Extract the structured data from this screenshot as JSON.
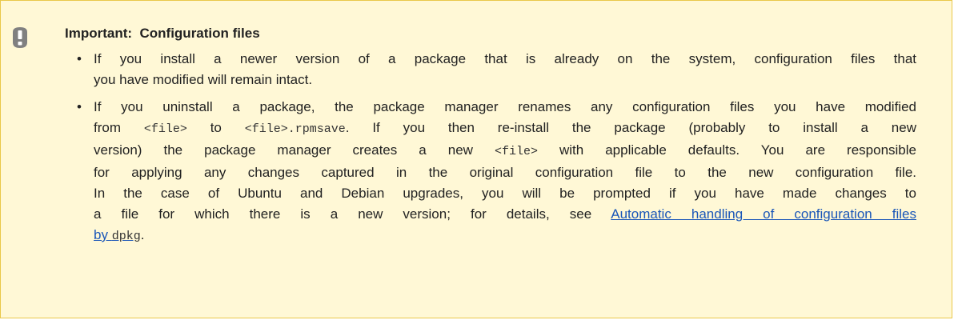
{
  "admonition": {
    "icon": "exclamation-icon",
    "title": "Important:  Configuration files",
    "colors": {
      "background": "#fff8d6",
      "border": "#e9c84a",
      "icon": "#808080",
      "link": "#1a56b8"
    }
  },
  "bullet1": {
    "l1": "If you install a newer version of a package that is already on the system, configuration files that",
    "l2": "you have modified will remain intact."
  },
  "bullet2": {
    "l1": "If you uninstall a package, the package manager renames any configuration files you have modified",
    "l2a": "from ",
    "l2code1": "<file>",
    "l2b": " to ",
    "l2code2": "<file>.rpmsave",
    "l2c": ". If you then re-install the package (probably to install a new",
    "l3a": "version) the package manager creates a new ",
    "l3code": "<file>",
    "l3b": " with applicable defaults. You are responsible",
    "l4": "for applying any changes captured in the original configuration file to the new configuration file.",
    "l5": "In the case of Ubuntu and Debian upgrades, you will be prompted if you have made changes to",
    "l6a": "a file for which there is a new version; for details, see ",
    "l6link": "Automatic handling of configuration files",
    "l7link": "by ",
    "l7code": "dpkg",
    "l7end": "."
  }
}
